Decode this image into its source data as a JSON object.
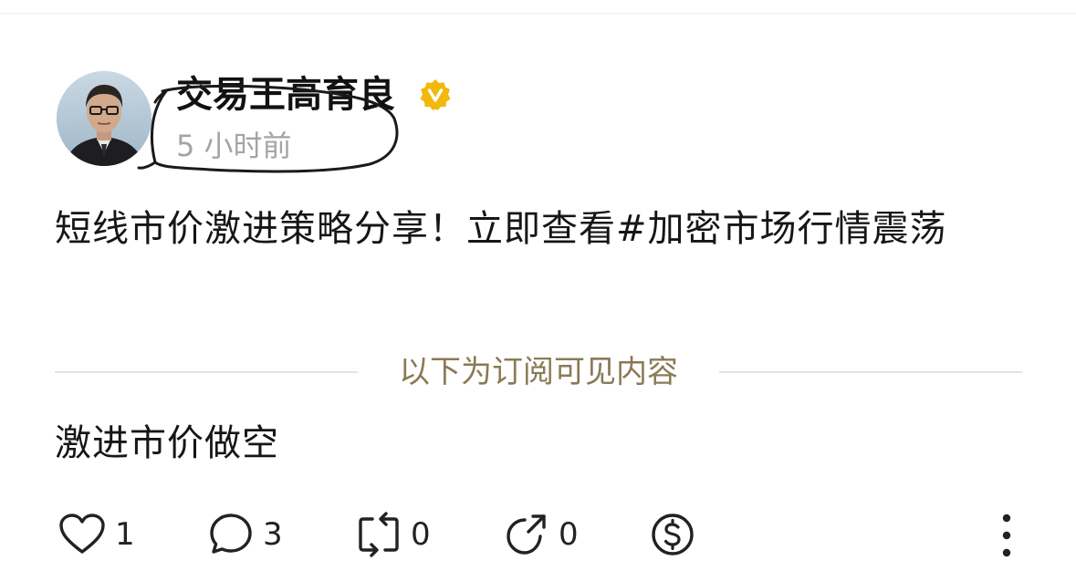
{
  "author": {
    "name": "交易王高育良",
    "time": "5 小时前",
    "verified": true
  },
  "post": {
    "body": "短线市价激进策略分享！立即查看#加密市场行情震荡",
    "divider_label": "以下为订阅可见内容",
    "subscriber_content": "激进市价做空"
  },
  "actions": {
    "likes": "1",
    "comments": "3",
    "reposts": "0",
    "shares": "0"
  },
  "colors": {
    "divider_text": "#8a7a55",
    "verified_badge": "#f0b90b",
    "time_text": "#a4a4a4"
  },
  "icons": [
    "heart-icon",
    "comment-icon",
    "repost-icon",
    "share-icon",
    "tip-icon",
    "more-icon",
    "verified-icon"
  ]
}
